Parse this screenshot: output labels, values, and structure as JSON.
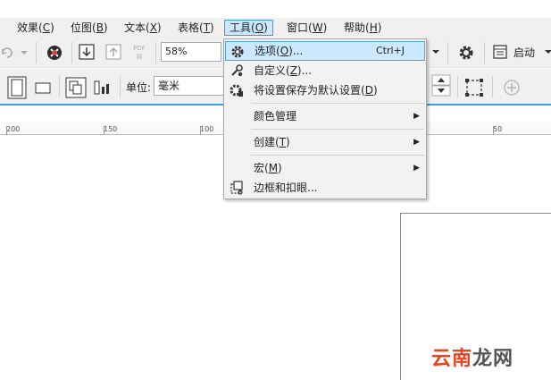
{
  "menubar": {
    "items": [
      {
        "label": "效果(",
        "key": "C",
        "tail": ")"
      },
      {
        "label": "位图(",
        "key": "B",
        "tail": ")"
      },
      {
        "label": "文本(",
        "key": "X",
        "tail": ")"
      },
      {
        "label": "表格(",
        "key": "T",
        "tail": ")"
      },
      {
        "label": "工具(",
        "key": "O",
        "tail": ")"
      },
      {
        "label": "窗口(",
        "key": "W",
        "tail": ")"
      },
      {
        "label": "帮助(",
        "key": "H",
        "tail": ")"
      }
    ]
  },
  "toolbar": {
    "zoom_value": "58%",
    "unit_label": "单位:",
    "unit_value": "毫米",
    "start_label": "启动",
    "pdf_label": "PDF"
  },
  "ruler": {
    "labels": [
      "200",
      "150",
      "100",
      "50"
    ]
  },
  "tools_menu": {
    "items": [
      {
        "label": "选项(",
        "key": "O",
        "tail": ")...",
        "shortcut": "Ctrl+J",
        "icon": "gear-icon"
      },
      {
        "label": "自定义(",
        "key": "Z",
        "tail": ")...",
        "shortcut": "",
        "icon": "customize-icon"
      },
      {
        "label": "将设置保存为默认设置(",
        "key": "D",
        "tail": ")",
        "shortcut": "",
        "icon": "save-settings-icon"
      },
      {
        "label": "颜色管理",
        "key": "",
        "tail": "",
        "shortcut": "",
        "icon": ""
      },
      {
        "label": "创建(",
        "key": "T",
        "tail": ")",
        "shortcut": "",
        "icon": ""
      },
      {
        "label": "宏(",
        "key": "M",
        "tail": ")",
        "shortcut": "",
        "icon": ""
      },
      {
        "label": "边框和扣眼...",
        "key": "",
        "tail": "",
        "shortcut": "",
        "icon": "borders-grommets-icon"
      }
    ]
  },
  "watermark": {
    "c1": "云",
    "c2": "南",
    "c3": "龙",
    "c4": "网"
  },
  "colors": {
    "menu_highlight": "#cce8ff",
    "menu_highlight_border": "#3c9be0",
    "accent_line": "#3aa0d8",
    "watermark_red": "#e8431c"
  }
}
